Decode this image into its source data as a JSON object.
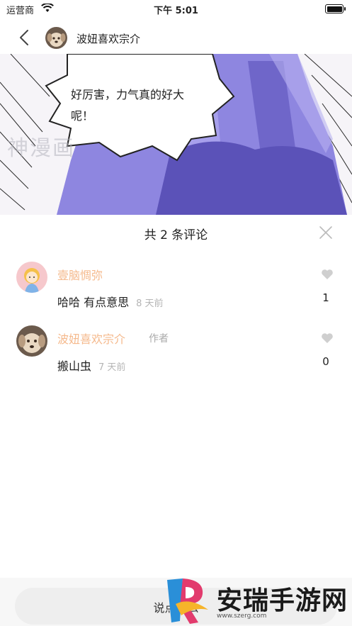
{
  "status_bar": {
    "carrier": "运营商",
    "time": "下午 5:01"
  },
  "nav": {
    "title": "波妞喜欢宗介"
  },
  "comic": {
    "bubble_text": "好厉害，力气真的好大呢！",
    "watermark": "神漫画"
  },
  "comments_panel": {
    "title": "共 2 条评论",
    "comments": [
      {
        "author": "壹脑惆弥",
        "role": "",
        "text": "哈哈 有点意思",
        "time": "8 天前",
        "likes": "1"
      },
      {
        "author": "波妞喜欢宗介",
        "role": "作者",
        "text": "搬山虫",
        "time": "7 天前",
        "likes": "0"
      }
    ]
  },
  "input": {
    "placeholder": "说点什么"
  },
  "watermark_logo": {
    "text": "安瑞手游网",
    "url": "www.szerg.com"
  },
  "colors": {
    "author_name": "#f5b98c",
    "comic_purple": "#8e86e0",
    "like_icon": "#cfcfcf"
  }
}
